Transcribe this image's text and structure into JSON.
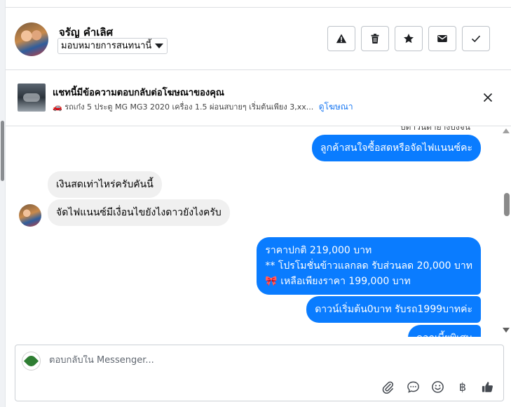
{
  "header": {
    "contact_name": "จรัญ คำเลิศ",
    "assign_label": "มอบหมายการสนทนานี้",
    "actions": [
      {
        "id": "spam",
        "icon": "warning-icon"
      },
      {
        "id": "delete",
        "icon": "trash-icon"
      },
      {
        "id": "star",
        "icon": "star-icon"
      },
      {
        "id": "unread",
        "icon": "envelope-icon"
      },
      {
        "id": "done",
        "icon": "check-icon"
      }
    ]
  },
  "ad_banner": {
    "title": "แชทนี้มีข้อความตอบกลับต่อโฆษณาของคุณ",
    "description": "รถเก๋ง 5 ประตู MG MG3 2020 เครื่อง 1.5 ผ่อนสบายๆ เริ่มต้นเพียง 3,xx...",
    "car_emoji": "🚗",
    "link_label": "ดูโฆษณา"
  },
  "conversation": {
    "clipped_top_text": "บดาวนต่ำยางบงจน",
    "messages": [
      {
        "direction": "out",
        "text": "ลูกค้าสนใจซื้อสดหรือจัดไฟแนนซ์คะ"
      },
      {
        "direction": "in",
        "text": "เงินสดเท่าไหร่ครับคันนี้"
      },
      {
        "direction": "in",
        "text": "จัดไฟแนนซ์มีเงื่อนไขยังไงดาวยังไงครับ"
      },
      {
        "direction": "out",
        "lines": [
          "ราคาปกติ 219,000 บาท",
          "** โปรโมชั่นข้าวแลกลด รับส่วนลด 20,000 บาท",
          "🎀  เหลือเพียงราคา 199,000 บาท"
        ]
      },
      {
        "direction": "out",
        "text": "ดาวน์เริ่มต้น0บาท รับรถ1999บาทค่ะ"
      },
      {
        "direction": "out",
        "text": "ดอกเบี้ยพิเศษ"
      }
    ]
  },
  "composer": {
    "placeholder": "ตอบกลับใน Messenger...",
    "tools": [
      "paperclip-icon",
      "chat-bubble-icon",
      "smiley-icon",
      "baht-icon",
      "thumbs-up-icon"
    ],
    "baht_symbol": "฿"
  },
  "colors": {
    "outgoing_bubble": "#0a7cff",
    "incoming_bubble": "#f0f0f0",
    "link": "#1877f2"
  }
}
